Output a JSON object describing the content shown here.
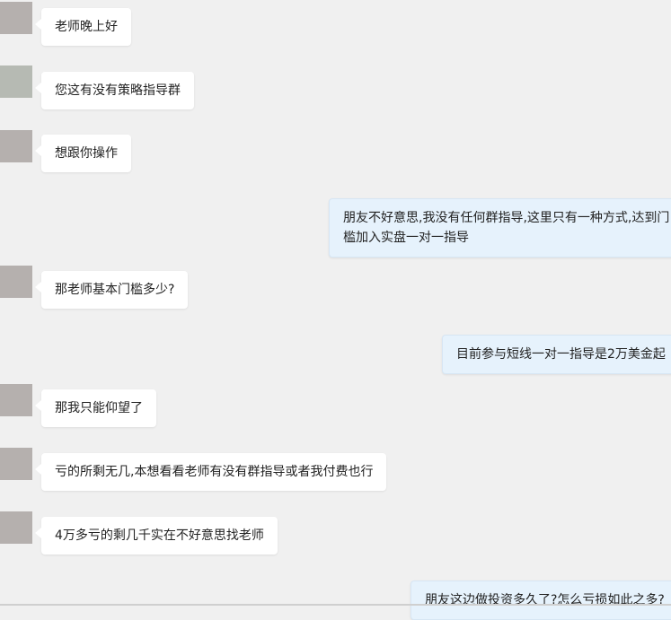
{
  "messages": [
    {
      "side": "left",
      "text": "老师晚上好"
    },
    {
      "side": "left",
      "text": "您这有没有策略指导群"
    },
    {
      "side": "left",
      "text": "想跟你操作"
    },
    {
      "side": "right",
      "text": "朋友不好意思,我没有任何群指导,这里只有一种方式,达到门槛加入实盘一对一指导"
    },
    {
      "side": "left",
      "text": "那老师基本门槛多少?"
    },
    {
      "side": "right",
      "text": "目前参与短线一对一指导是2万美金起"
    },
    {
      "side": "left",
      "text": "那我只能仰望了"
    },
    {
      "side": "left",
      "text": "亏的所剩无几,本想看看老师有没有群指导或者我付费也行"
    },
    {
      "side": "left",
      "text": "4万多亏的剩几千实在不好意思找老师"
    },
    {
      "side": "right",
      "text": "朋友这边做投资多久了?怎么亏损如此之多?"
    }
  ],
  "colors": {
    "background": "#f0f0f0",
    "left_bubble": "#ffffff",
    "right_bubble": "#e6f2fc",
    "avatar": "#b5b0ae"
  }
}
